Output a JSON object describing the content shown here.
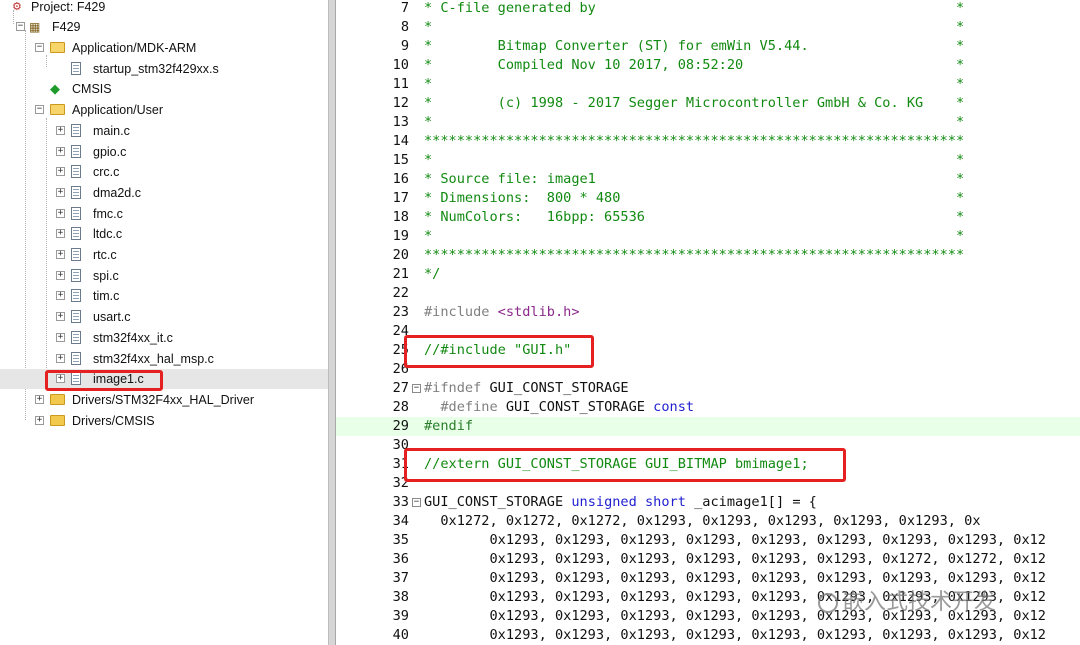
{
  "project_tree": {
    "project_label": "Project: F429",
    "target_label": "F429",
    "items": [
      {
        "label": "Application/MDK-ARM",
        "kind": "folder-open"
      },
      {
        "label": "startup_stm32f429xx.s",
        "kind": "file"
      },
      {
        "label": "CMSIS",
        "kind": "gem"
      },
      {
        "label": "Application/User",
        "kind": "folder-open"
      },
      {
        "label": "main.c",
        "kind": "file"
      },
      {
        "label": "gpio.c",
        "kind": "file"
      },
      {
        "label": "crc.c",
        "kind": "file"
      },
      {
        "label": "dma2d.c",
        "kind": "file"
      },
      {
        "label": "fmc.c",
        "kind": "file"
      },
      {
        "label": "ltdc.c",
        "kind": "file"
      },
      {
        "label": "rtc.c",
        "kind": "file"
      },
      {
        "label": "spi.c",
        "kind": "file"
      },
      {
        "label": "tim.c",
        "kind": "file"
      },
      {
        "label": "usart.c",
        "kind": "file"
      },
      {
        "label": "stm32f4xx_it.c",
        "kind": "file"
      },
      {
        "label": "stm32f4xx_hal_msp.c",
        "kind": "file"
      },
      {
        "label": "image1.c",
        "kind": "file",
        "selected": true
      },
      {
        "label": "Drivers/STM32F4xx_HAL_Driver",
        "kind": "folder"
      },
      {
        "label": "Drivers/CMSIS",
        "kind": "folder"
      }
    ]
  },
  "editor": {
    "lines": [
      {
        "n": "7",
        "t": "* C-file generated by                                            *",
        "c": "com"
      },
      {
        "n": "8",
        "t": "*                                                                *",
        "c": "com"
      },
      {
        "n": "9",
        "t": "*        Bitmap Converter (ST) for emWin V5.44.                  *",
        "c": "com"
      },
      {
        "n": "10",
        "t": "*        Compiled Nov 10 2017, 08:52:20                          *",
        "c": "com"
      },
      {
        "n": "11",
        "t": "*                                                                *",
        "c": "com"
      },
      {
        "n": "12",
        "t": "*        (c) 1998 - 2017 Segger Microcontroller GmbH & Co. KG    *",
        "c": "com"
      },
      {
        "n": "13",
        "t": "*                                                                *",
        "c": "com"
      },
      {
        "n": "14",
        "t": "******************************************************************",
        "c": "com"
      },
      {
        "n": "15",
        "t": "*                                                                *",
        "c": "com"
      },
      {
        "n": "16",
        "t": "* Source file: image1                                            *",
        "c": "com"
      },
      {
        "n": "17",
        "t": "* Dimensions:  800 * 480                                         *",
        "c": "com"
      },
      {
        "n": "18",
        "t": "* NumColors:   16bpp: 65536                                      *",
        "c": "com"
      },
      {
        "n": "19",
        "t": "*                                                                *",
        "c": "com"
      },
      {
        "n": "20",
        "t": "******************************************************************",
        "c": "com"
      },
      {
        "n": "21",
        "t": "*/",
        "c": "com"
      },
      {
        "n": "22",
        "t": "",
        "c": "txt"
      },
      {
        "n": "23",
        "t": "#include <stdlib.h>",
        "c": "include"
      },
      {
        "n": "24",
        "t": "",
        "c": "txt"
      },
      {
        "n": "25",
        "t": "//#include \"GUI.h\"",
        "c": "com"
      },
      {
        "n": "26",
        "t": "",
        "c": "txt"
      },
      {
        "n": "27",
        "t": "#ifndef GUI_CONST_STORAGE",
        "c": "ifndef",
        "fold": true
      },
      {
        "n": "28",
        "t": "  #define GUI_CONST_STORAGE const",
        "c": "define"
      },
      {
        "n": "29",
        "t": "#endif",
        "c": "pp",
        "hl": true
      },
      {
        "n": "30",
        "t": "",
        "c": "txt"
      },
      {
        "n": "31",
        "t": "//extern GUI_CONST_STORAGE GUI_BITMAP bmimage1;",
        "c": "com"
      },
      {
        "n": "32",
        "t": "",
        "c": "txt"
      },
      {
        "n": "33",
        "t": "GUI_CONST_STORAGE unsigned short _acimage1[] = {",
        "c": "decl",
        "fold": true
      },
      {
        "n": "34",
        "t": "  0x1272, 0x1272, 0x1272, 0x1293, 0x1293, 0x1293, 0x1293, 0x1293, 0x",
        "c": "txt"
      },
      {
        "n": "35",
        "t": "        0x1293, 0x1293, 0x1293, 0x1293, 0x1293, 0x1293, 0x1293, 0x1293, 0x12",
        "c": "txt"
      },
      {
        "n": "36",
        "t": "        0x1293, 0x1293, 0x1293, 0x1293, 0x1293, 0x1293, 0x1272, 0x1272, 0x12",
        "c": "txt"
      },
      {
        "n": "37",
        "t": "        0x1293, 0x1293, 0x1293, 0x1293, 0x1293, 0x1293, 0x1293, 0x1293, 0x12",
        "c": "txt"
      },
      {
        "n": "38",
        "t": "        0x1293, 0x1293, 0x1293, 0x1293, 0x1293, 0x1293, 0x1293, 0x1293, 0x12",
        "c": "txt"
      },
      {
        "n": "39",
        "t": "        0x1293, 0x1293, 0x1293, 0x1293, 0x1293, 0x1293, 0x1293, 0x1293, 0x12",
        "c": "txt"
      },
      {
        "n": "40",
        "t": "        0x1293, 0x1293, 0x1293, 0x1293, 0x1293, 0x1293, 0x1293, 0x1293, 0x12",
        "c": "txt"
      }
    ]
  },
  "watermark": "嵌入式技术开发",
  "colors": {
    "highlight_box": "#e52020",
    "comment": "#128a12",
    "keyword": "#1f1fd0",
    "string": "#8b2a8b"
  }
}
